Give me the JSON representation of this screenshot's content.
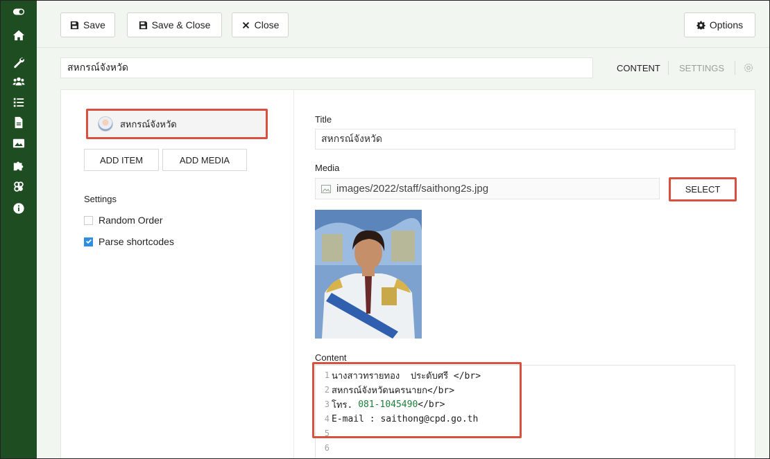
{
  "sidebar": {
    "items": [
      {
        "icon": "toggle-icon"
      },
      {
        "icon": "home-icon"
      },
      {
        "icon": "wrench-icon"
      },
      {
        "icon": "users-icon"
      },
      {
        "icon": "list-icon"
      },
      {
        "icon": "file-icon"
      },
      {
        "icon": "image-icon"
      },
      {
        "icon": "puzzle-icon"
      },
      {
        "icon": "layers-icon"
      },
      {
        "icon": "info-icon"
      }
    ],
    "bg_color": "#1e4d22"
  },
  "toolbar": {
    "save_label": "Save",
    "save_close_label": "Save & Close",
    "close_label": "Close",
    "options_label": "Options"
  },
  "header": {
    "title_value": "สหกรณ์จังหวัด",
    "tab_content": "CONTENT",
    "tab_settings": "SETTINGS"
  },
  "left": {
    "item_label": "สหกรณ์จังหวัด",
    "add_item_label": "ADD ITEM",
    "add_media_label": "ADD MEDIA",
    "settings_label": "Settings",
    "random_order_label": "Random Order",
    "random_order_checked": false,
    "parse_shortcodes_label": "Parse shortcodes",
    "parse_shortcodes_checked": true
  },
  "right": {
    "title_label": "Title",
    "title_value": "สหกรณ์จังหวัด",
    "media_label": "Media",
    "media_value": "images/2022/staff/saithong2s.jpg",
    "select_label": "SELECT",
    "content_label": "Content"
  },
  "editor": {
    "lines": [
      {
        "n": "1",
        "text": "นางสาวทรายทอง  ประดับศรี </br>"
      },
      {
        "n": "2",
        "text": "สหกรณ์จังหวัดนครนายก</br>"
      },
      {
        "n": "3",
        "pre": "โทร. ",
        "num": "081-1045490",
        "post": "</br>"
      },
      {
        "n": "4",
        "text": "E-mail : saithong@cpd.go.th"
      },
      {
        "n": "5",
        "text": ""
      },
      {
        "n": "6",
        "text": ""
      }
    ]
  },
  "colors": {
    "highlight": "#d9503f",
    "checkbox": "#2e8fe0",
    "number_green": "#1a7f37"
  }
}
